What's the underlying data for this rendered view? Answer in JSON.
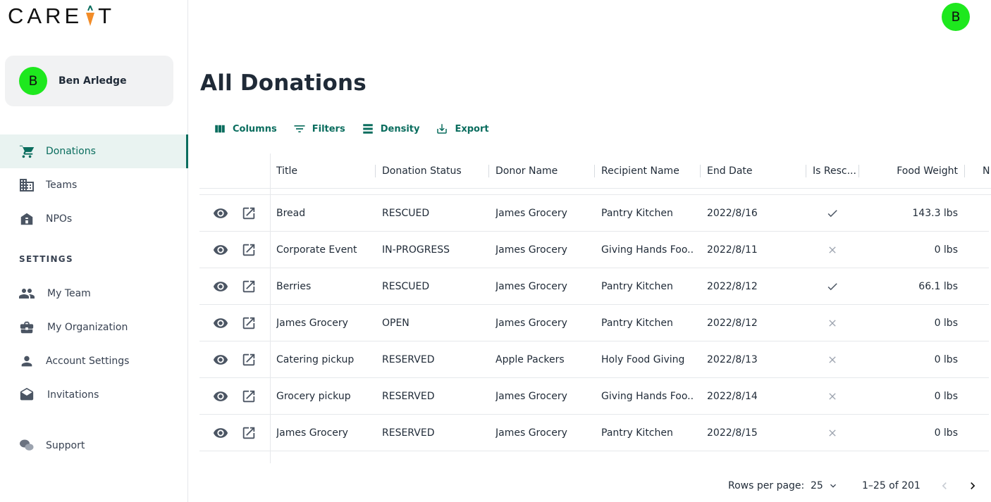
{
  "brand": {
    "logo_text_left": "CARE",
    "logo_text_right": "T",
    "accent": "#0a6d5e",
    "avatar_color": "#1ee81e",
    "carrot_color": "#f28c28"
  },
  "user": {
    "initial": "B",
    "name": "Ben Arledge"
  },
  "nav": {
    "items": [
      {
        "label": "Donations",
        "icon": "cart-icon",
        "active": true
      },
      {
        "label": "Teams",
        "icon": "building-icon"
      },
      {
        "label": "NPOs",
        "icon": "home-icon"
      }
    ],
    "settings_heading": "SETTINGS",
    "settings_items": [
      {
        "label": "My Team",
        "icon": "people-icon"
      },
      {
        "label": "My Organization",
        "icon": "briefcase-icon"
      },
      {
        "label": "Account Settings",
        "icon": "person-icon"
      },
      {
        "label": "Invitations",
        "icon": "mail-icon"
      }
    ],
    "support_label": "Support"
  },
  "page": {
    "title": "All Donations"
  },
  "toolbar": {
    "columns": "Columns",
    "filters": "Filters",
    "density": "Density",
    "export": "Export"
  },
  "table": {
    "headers": {
      "title": "Title",
      "status": "Donation Status",
      "donor": "Donor Name",
      "recipient": "Recipient Name",
      "end_date": "End Date",
      "is_rescued": "Is Resc...",
      "food_weight": "Food Weight",
      "next": "N"
    },
    "rows": [
      {
        "title": "Bread",
        "status": "RESCUED",
        "donor": "James Grocery",
        "recipient": "Pantry Kitchen",
        "end_date": "2022/8/16",
        "rescued": true,
        "weight": "143.3 lbs"
      },
      {
        "title": "Corporate Event",
        "status": "IN-PROGRESS",
        "donor": "James Grocery",
        "recipient": "Giving Hands Foo...",
        "end_date": "2022/8/11",
        "rescued": false,
        "weight": "0 lbs"
      },
      {
        "title": "Berries",
        "status": "RESCUED",
        "donor": "James Grocery",
        "recipient": "Pantry Kitchen",
        "end_date": "2022/8/12",
        "rescued": true,
        "weight": "66.1 lbs"
      },
      {
        "title": "James Grocery",
        "status": "OPEN",
        "donor": "James Grocery",
        "recipient": "Pantry Kitchen",
        "end_date": "2022/8/12",
        "rescued": false,
        "weight": "0 lbs"
      },
      {
        "title": "Catering pickup",
        "status": "RESERVED",
        "donor": "Apple Packers",
        "recipient": "Holy Food Giving",
        "end_date": "2022/8/13",
        "rescued": false,
        "weight": "0 lbs"
      },
      {
        "title": "Grocery pickup",
        "status": "RESERVED",
        "donor": "James Grocery",
        "recipient": "Giving Hands Foo...",
        "end_date": "2022/8/14",
        "rescued": false,
        "weight": "0 lbs"
      },
      {
        "title": "James Grocery",
        "status": "RESERVED",
        "donor": "James Grocery",
        "recipient": "Pantry Kitchen",
        "end_date": "2022/8/15",
        "rescued": false,
        "weight": "0 lbs"
      }
    ]
  },
  "pagination": {
    "rows_per_page_label": "Rows per page:",
    "rows_per_page": "25",
    "range": "1–25 of 201"
  }
}
